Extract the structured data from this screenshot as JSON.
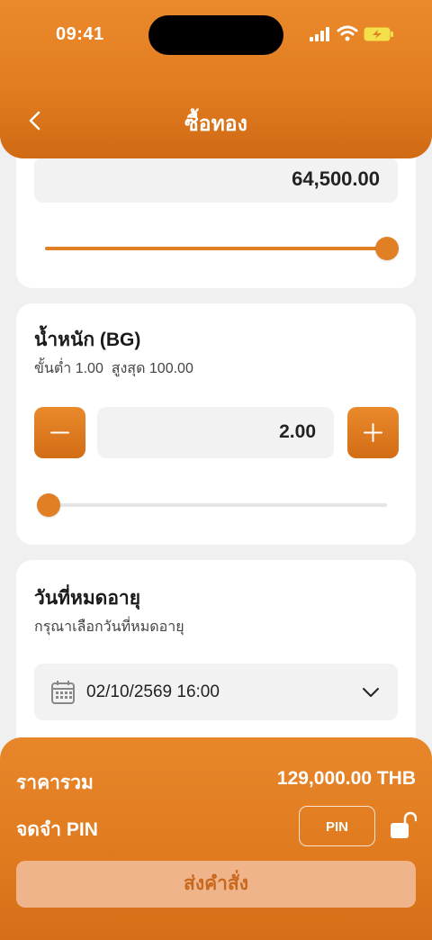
{
  "status_bar": {
    "time": "09:41"
  },
  "header": {
    "title": "ซื้อทอง"
  },
  "amount_card": {
    "amount_value": "64,500.00",
    "slider_fraction": 1.0
  },
  "weight_card": {
    "title": "น้ำหนัก (BG)",
    "limits_text": "ขั้นต่ำ 1.00  สูงสุด 100.00",
    "quantity_value": "2.00",
    "slider_fraction": 0.01
  },
  "expiry_card": {
    "title": "วันที่หมดอายุ",
    "subtitle": "กรุณาเลือกวันที่หมดอายุ",
    "date_value": "02/10/2569 16:00"
  },
  "summary": {
    "total_label": "ราคารวม",
    "total_value": "129,000.00 THB",
    "pin_label": "จดจำ PIN",
    "pin_button": "PIN",
    "submit_label": "ส่งคำสั่ง"
  },
  "colors": {
    "accent": "#e07f24",
    "submit_disabled_bg": "#efb48a",
    "submit_disabled_text": "#c9671c"
  },
  "icons": [
    "back-icon",
    "minus-icon",
    "plus-icon",
    "calendar-icon",
    "chevron-down-icon",
    "unlock-icon",
    "signal-icon",
    "wifi-icon",
    "battery-icon"
  ]
}
